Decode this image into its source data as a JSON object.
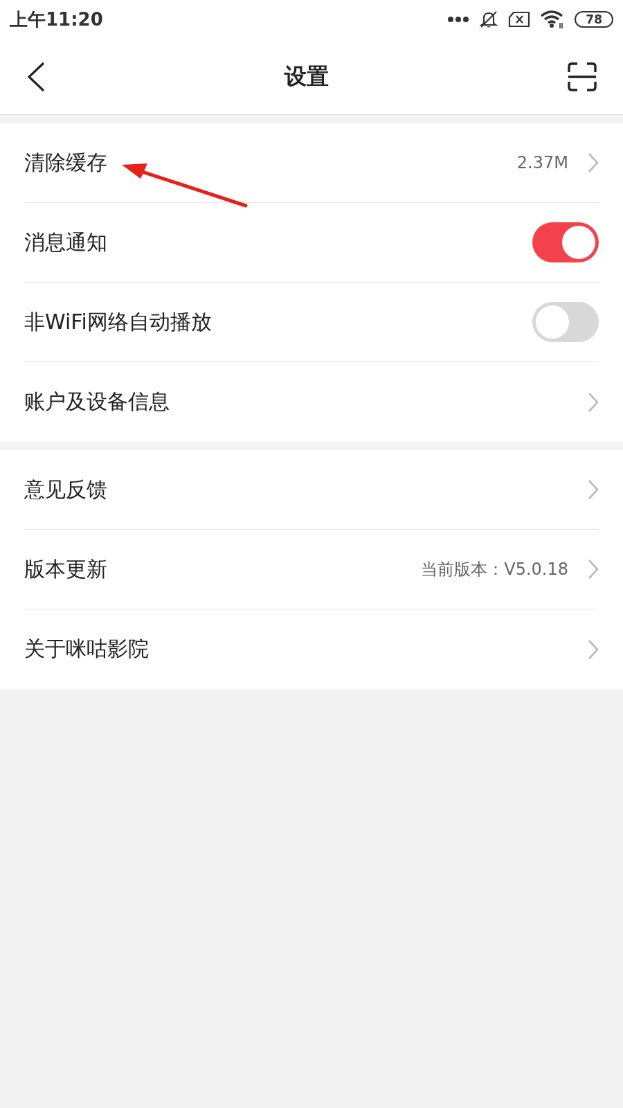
{
  "status_bar": {
    "time": "上午11:20",
    "battery": "78"
  },
  "header": {
    "title": "设置"
  },
  "groups": [
    {
      "rows": [
        {
          "kind": "chevron",
          "label": "清除缓存",
          "value": "2.37M"
        },
        {
          "kind": "toggle",
          "label": "消息通知",
          "on": true
        },
        {
          "kind": "toggle",
          "label": "非WiFi网络自动播放",
          "on": false
        },
        {
          "kind": "chevron",
          "label": "账户及设备信息"
        }
      ]
    },
    {
      "rows": [
        {
          "kind": "chevron",
          "label": "意见反馈"
        },
        {
          "kind": "chevron",
          "label": "版本更新",
          "value": "当前版本：V5.0.18"
        },
        {
          "kind": "chevron",
          "label": "关于咪咕影院"
        }
      ]
    }
  ],
  "annotation": {
    "kind": "arrow"
  }
}
